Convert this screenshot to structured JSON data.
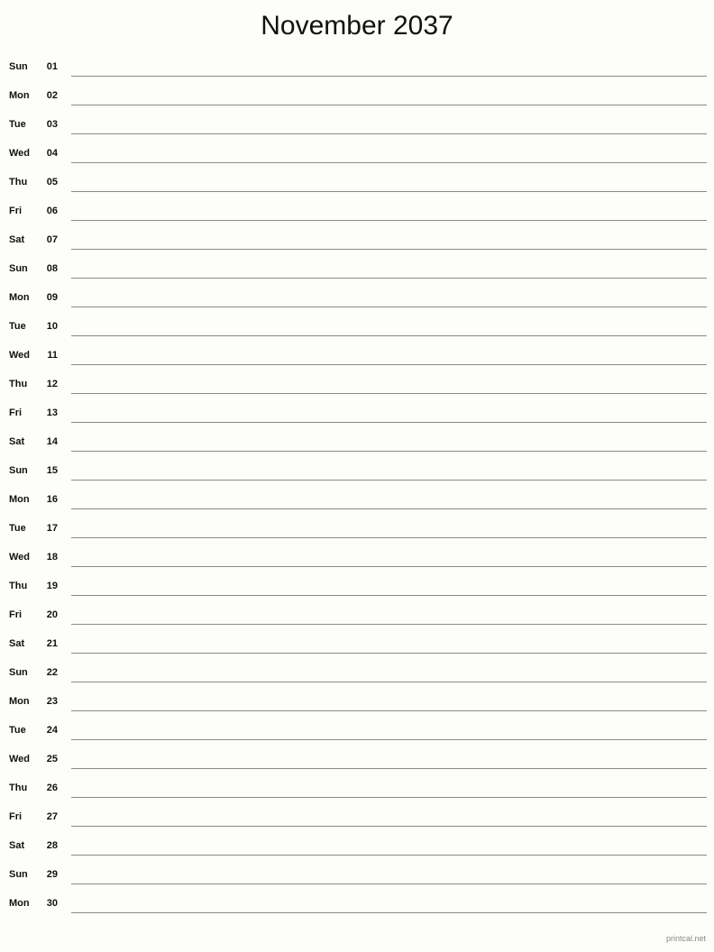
{
  "document": {
    "title": "November 2037",
    "month": "November",
    "year": "2037",
    "type": "printable-monthly-calendar",
    "layout": "single-column-notes-lines"
  },
  "calendar": {
    "rows": [
      {
        "weekday": "Sun",
        "date": "01"
      },
      {
        "weekday": "Mon",
        "date": "02"
      },
      {
        "weekday": "Tue",
        "date": "03"
      },
      {
        "weekday": "Wed",
        "date": "04"
      },
      {
        "weekday": "Thu",
        "date": "05"
      },
      {
        "weekday": "Fri",
        "date": "06"
      },
      {
        "weekday": "Sat",
        "date": "07"
      },
      {
        "weekday": "Sun",
        "date": "08"
      },
      {
        "weekday": "Mon",
        "date": "09"
      },
      {
        "weekday": "Tue",
        "date": "10"
      },
      {
        "weekday": "Wed",
        "date": "11"
      },
      {
        "weekday": "Thu",
        "date": "12"
      },
      {
        "weekday": "Fri",
        "date": "13"
      },
      {
        "weekday": "Sat",
        "date": "14"
      },
      {
        "weekday": "Sun",
        "date": "15"
      },
      {
        "weekday": "Mon",
        "date": "16"
      },
      {
        "weekday": "Tue",
        "date": "17"
      },
      {
        "weekday": "Wed",
        "date": "18"
      },
      {
        "weekday": "Thu",
        "date": "19"
      },
      {
        "weekday": "Fri",
        "date": "20"
      },
      {
        "weekday": "Sat",
        "date": "21"
      },
      {
        "weekday": "Sun",
        "date": "22"
      },
      {
        "weekday": "Mon",
        "date": "23"
      },
      {
        "weekday": "Tue",
        "date": "24"
      },
      {
        "weekday": "Wed",
        "date": "25"
      },
      {
        "weekday": "Thu",
        "date": "26"
      },
      {
        "weekday": "Fri",
        "date": "27"
      },
      {
        "weekday": "Sat",
        "date": "28"
      },
      {
        "weekday": "Sun",
        "date": "29"
      },
      {
        "weekday": "Mon",
        "date": "30"
      }
    ]
  },
  "footer": {
    "credit": "printcal.net"
  },
  "colors": {
    "page_background": "#fdfdfa",
    "text": "#111111",
    "rule_line": "#8a8a86",
    "footer_text": "#888885"
  }
}
